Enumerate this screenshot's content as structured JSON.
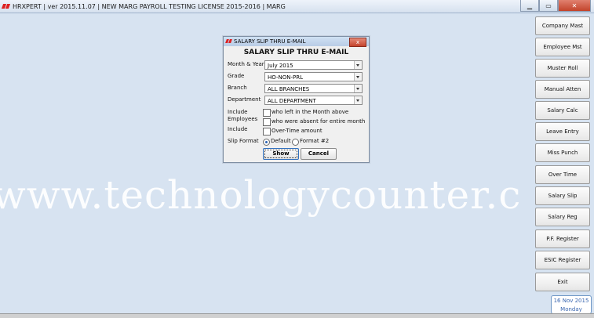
{
  "window": {
    "title": "HRXPERT | ver 2015.11.07 | NEW MARG PAYROLL TESTING LICENSE 2015-2016 | MARG"
  },
  "dialog": {
    "title": "SALARY SLIP THRU E-MAIL",
    "heading": "SALARY SLIP THRU E-MAIL",
    "close_label": "x",
    "fields": [
      {
        "label": "Month & Year",
        "value": "July 2015"
      },
      {
        "label": "Grade",
        "value": "HO-NON-PRL"
      },
      {
        "label": "Branch",
        "value": "ALL BRANCHES"
      },
      {
        "label": "Department",
        "value": "ALL DEPARTMENT"
      }
    ],
    "include_label1": "Include",
    "include_label2": "Employees",
    "include_label3": "Include",
    "checks": [
      "who left in the Month above",
      "who were absent for entire month",
      "Over-Time amount"
    ],
    "slip_format_label": "Slip Format",
    "radio_default": "Default",
    "radio_format2": "Format #2",
    "show_label": "Show",
    "cancel_label": "Cancel"
  },
  "sidebar": [
    "Company Mast",
    "Employee Mst",
    "Muster Roll",
    "Manual Atten",
    "Salary Calc",
    "Leave Entry",
    "Miss Punch",
    "Over Time",
    "Salary Slip",
    "Salary Reg",
    "P.F. Register",
    "ESIC Register",
    "Exit"
  ],
  "date": {
    "date": "16 Nov 2015",
    "day": "Monday"
  },
  "watermark": "www.technologycounter.c"
}
